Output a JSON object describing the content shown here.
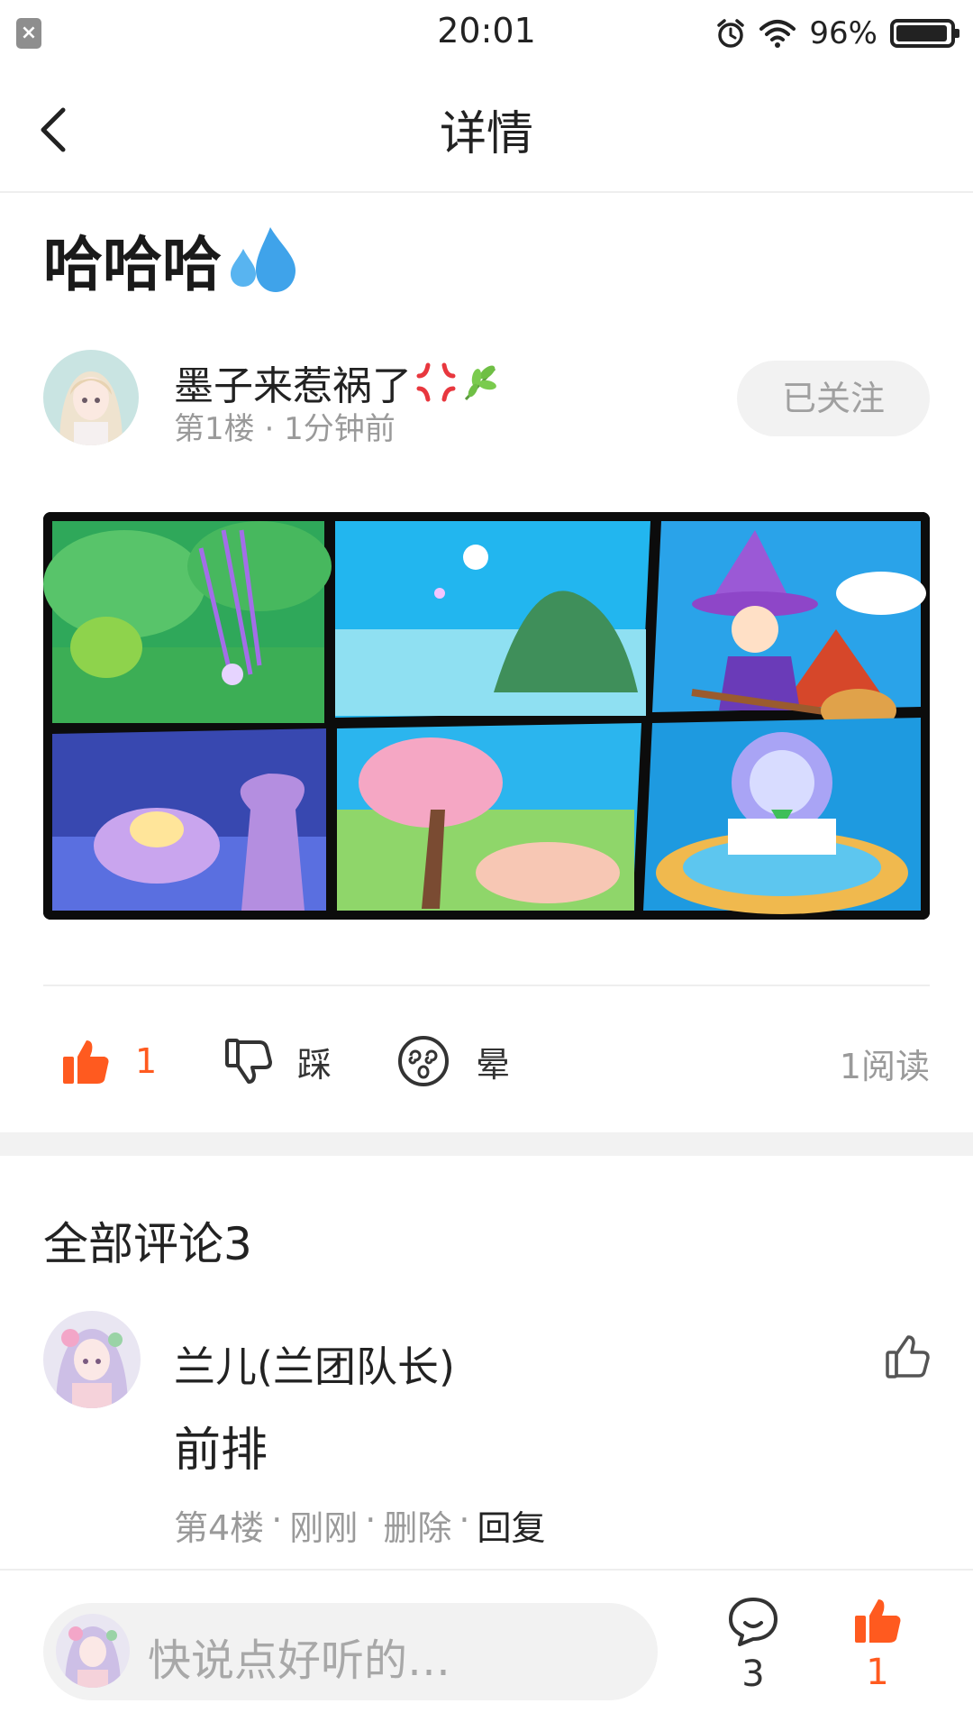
{
  "status_bar": {
    "time": "20:01",
    "battery": "96%",
    "battery_level": 0.96
  },
  "nav": {
    "title": "详情"
  },
  "post": {
    "title": "哈哈哈",
    "author": {
      "name": "墨子来惹祸了",
      "floor": "第1楼",
      "time": "1分钟前",
      "follow_label": "已关注"
    },
    "actions": {
      "like_count": "1",
      "dislike_label": "踩",
      "dizzy_label": "晕",
      "read_count": "1阅读"
    }
  },
  "comments": {
    "heading": "全部评论3",
    "items": [
      {
        "author": "兰儿(兰团队长)",
        "text": "前排",
        "floor": "第4楼",
        "time": "刚刚",
        "delete_label": "删除",
        "reply_label": "回复"
      }
    ]
  },
  "bottom_bar": {
    "placeholder": "快说点好听的…",
    "comment_count": "3",
    "like_count": "1"
  },
  "colors": {
    "accent": "#ff5a1f",
    "muted": "#9a9a9a"
  }
}
